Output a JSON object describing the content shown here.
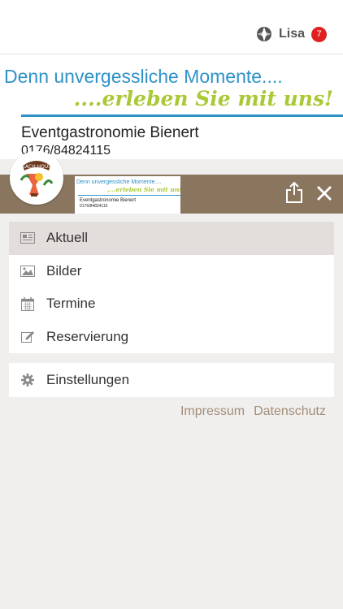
{
  "user": {
    "name": "Lisa",
    "notification_count": "7"
  },
  "banner": {
    "line1": "Denn unvergessliche Momente....",
    "line2": "....erleben Sie mit uns!",
    "company": "Eventgastronomie Bienert",
    "phone": "0176/84824115"
  },
  "logo": {
    "text": "BEACH HOUSE"
  },
  "menu": {
    "items": [
      {
        "label": "Aktuell",
        "icon": "newspaper-icon"
      },
      {
        "label": "Bilder",
        "icon": "image-icon"
      },
      {
        "label": "Termine",
        "icon": "calendar-icon"
      },
      {
        "label": "Reservierung",
        "icon": "edit-icon"
      }
    ],
    "settings": {
      "label": "Einstellungen",
      "icon": "gear-icon"
    }
  },
  "footer": {
    "impressum": "Impressum",
    "datenschutz": "Datenschutz"
  },
  "colors": {
    "header_brown": "#8a755f",
    "link_brown": "#a38d77",
    "active_bg": "#e3dedb",
    "badge_red": "#e02020"
  }
}
